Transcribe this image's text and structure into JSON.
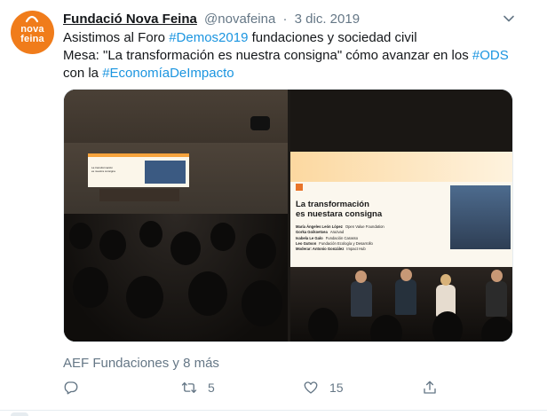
{
  "tweet": {
    "author": {
      "display_name": "Fundació Nova Feina",
      "handle": "@novafeina",
      "separator": "·",
      "date": "3 dic. 2019",
      "avatar_text": [
        "nova",
        "feina"
      ]
    },
    "text_lines": [
      [
        {
          "text": "Asistimos al Foro ",
          "type": "text"
        },
        {
          "text": "#Demos2019",
          "type": "hashtag"
        },
        {
          "text": " fundaciones y sociedad civil",
          "type": "text"
        }
      ],
      [
        {
          "text": "Mesa: \"La transformación es nuestra consigna\" cómo avanzar en los ",
          "type": "text"
        },
        {
          "text": "#ODS",
          "type": "hashtag"
        }
      ],
      [
        {
          "text": " con la ",
          "type": "text"
        },
        {
          "text": "#EconomíaDeImpacto",
          "type": "hashtag"
        }
      ]
    ],
    "media": {
      "left_photo": {
        "screen_text": [
          "La transformación",
          "es nuestra consigna"
        ]
      },
      "right_photo": {
        "screen_title": [
          "La transformación",
          "es nuestara consigna"
        ],
        "speakers": [
          {
            "name": "María Ángeles León López",
            "org": "Open Value Foundation"
          },
          {
            "name": "Gorka Goikoetxea",
            "org": "Arazvad"
          },
          {
            "name": "Isabela Le Galo",
            "org": "Fundación Carasso"
          },
          {
            "name": "Leo Gutson",
            "org": "Fundación Ecología y Desarrollo"
          },
          {
            "name": "Moderar: Antonio González",
            "org": "Impact Hub"
          }
        ]
      }
    },
    "tagged": "AEF Fundaciones y 8 más",
    "actions": {
      "reply": {
        "icon": "reply-icon",
        "count": ""
      },
      "retweet": {
        "icon": "retweet-icon",
        "count": "5"
      },
      "like": {
        "icon": "heart-icon",
        "count": "15"
      },
      "share": {
        "icon": "share-icon",
        "count": ""
      }
    }
  },
  "colors": {
    "brand_orange": "#f07c1b",
    "link_blue": "#1b95e0",
    "muted_gray": "#657786",
    "text": "#14171a"
  }
}
